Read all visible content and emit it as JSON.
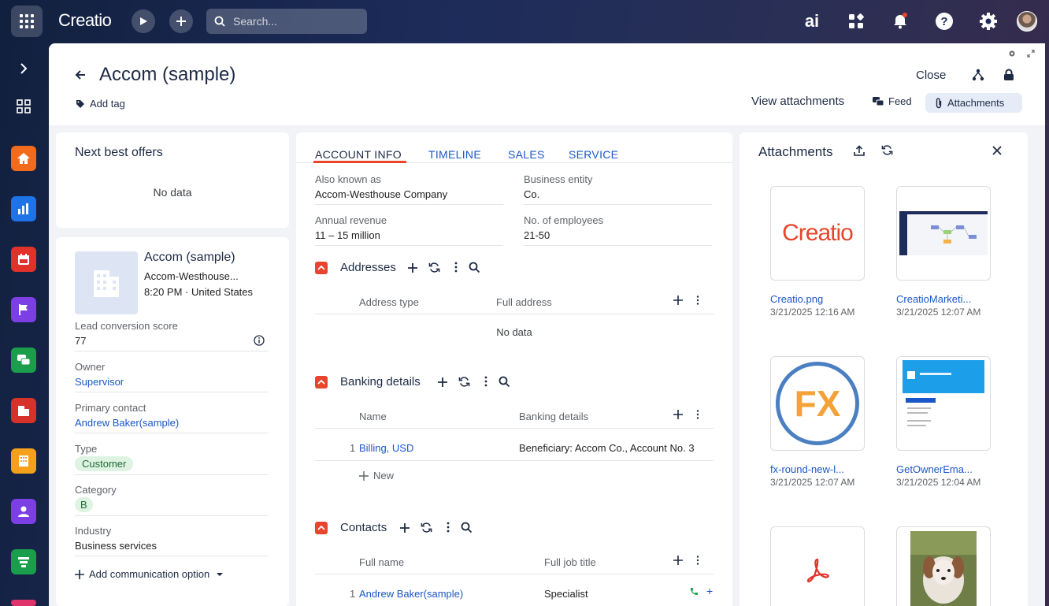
{
  "topbar": {
    "logo": "Creatio",
    "search_placeholder": "Search...",
    "ai_label": "ai"
  },
  "header": {
    "title": "Accom (sample)",
    "add_tag": "Add tag",
    "close": "Close",
    "view_attachments": "View attachments",
    "feed": "Feed",
    "attachments": "Attachments"
  },
  "offers": {
    "title": "Next best offers",
    "empty": "No data"
  },
  "profile": {
    "name": "Accom (sample)",
    "alt_name": "Accom-Westhouse...",
    "time_country": "8:20 PM · United States",
    "fields": {
      "score_label": "Lead conversion score",
      "score_value": "77",
      "owner_label": "Owner",
      "owner_value": "Supervisor",
      "contact_label": "Primary contact",
      "contact_value": "Andrew Baker(sample)",
      "type_label": "Type",
      "type_value": "Customer",
      "category_label": "Category",
      "category_value": "B",
      "industry_label": "Industry",
      "industry_value": "Business services"
    },
    "add_comm": "Add communication option"
  },
  "tabs": [
    "ACCOUNT INFO",
    "TIMELINE",
    "SALES",
    "SERVICE"
  ],
  "info": {
    "aka_label": "Also known as",
    "aka_value": "Accom-Westhouse Company",
    "entity_label": "Business entity",
    "entity_value": "Co.",
    "revenue_label": "Annual revenue",
    "revenue_value": "11 – 15 million",
    "employees_label": "No. of employees",
    "employees_value": "21-50"
  },
  "addresses": {
    "title": "Addresses",
    "col1": "Address type",
    "col2": "Full address",
    "empty": "No data"
  },
  "banking": {
    "title": "Banking details",
    "col1": "Name",
    "col2": "Banking details",
    "row_num": "1",
    "row_name": "Billing, USD",
    "row_details": "Beneficiary: Accom Co., Account No. 3",
    "new": "New"
  },
  "contacts": {
    "title": "Contacts",
    "col1": "Full name",
    "col2": "Full job title",
    "row_num": "1",
    "row_name": "Andrew Baker(sample)",
    "row_title": "Specialist"
  },
  "attachments": {
    "title": "Attachments",
    "files": [
      {
        "name": "Creatio.png",
        "date": "3/21/2025 12:16 AM",
        "thumb_text": "Creatio"
      },
      {
        "name": "CreatioMarketi...",
        "date": "3/21/2025 12:07 AM"
      },
      {
        "name": "fx-round-new-l...",
        "date": "3/21/2025 12:07 AM",
        "thumb_text": "FX"
      },
      {
        "name": "GetOwnerEma...",
        "date": "3/21/2025 12:04 AM"
      }
    ]
  },
  "colors": {
    "accent": "#1a56c8",
    "collapse": "#e8452c",
    "creatio_red": "#e8452c"
  }
}
